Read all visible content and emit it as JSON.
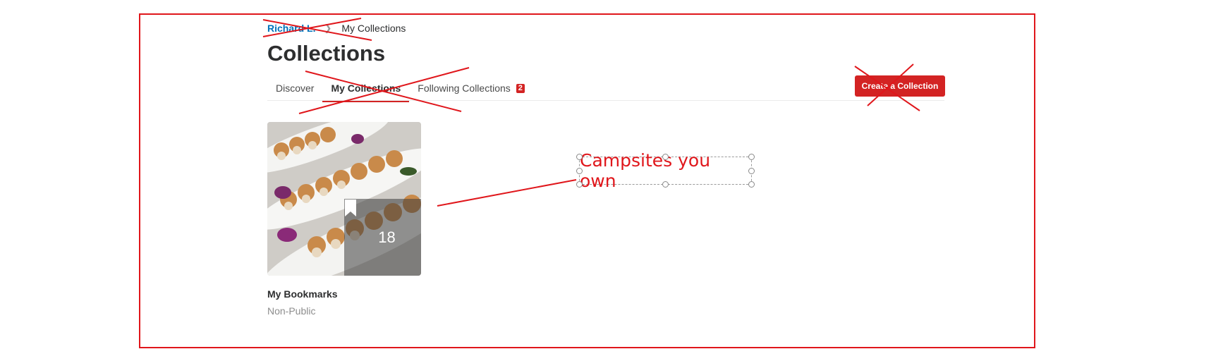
{
  "breadcrumb": {
    "user_link": "Richard L.",
    "current": "My Collections"
  },
  "page": {
    "title": "Collections"
  },
  "tabs": [
    {
      "label": "Discover"
    },
    {
      "label": "My Collections"
    },
    {
      "label": "Following Collections",
      "badge": "2"
    }
  ],
  "actions": {
    "create_label": "Create a Collection"
  },
  "collections": [
    {
      "title": "My Bookmarks",
      "privacy": "Non-Public",
      "count": "18"
    }
  ],
  "annotation": {
    "text": "Campsites you own",
    "color": "#e0161b"
  },
  "colors": {
    "brand_red": "#d32323",
    "link_blue": "#0073bb"
  }
}
